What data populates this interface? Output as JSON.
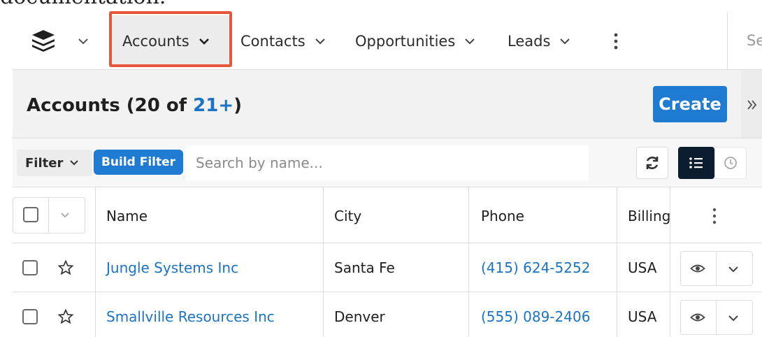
{
  "caption": "documentation.",
  "nav": {
    "tabs": [
      {
        "label": "Accounts"
      },
      {
        "label": "Contacts"
      },
      {
        "label": "Opportunities"
      },
      {
        "label": "Leads"
      }
    ],
    "search_placeholder": "Sea"
  },
  "list": {
    "title": "Accounts (20 of ",
    "count": "21+",
    "title_close": ")",
    "create_label": "Create"
  },
  "filter": {
    "filter_label": "Filter",
    "build_filter_label": "Build Filter",
    "search_placeholder": "Search by name..."
  },
  "table": {
    "columns": [
      "Name",
      "City",
      "Phone",
      "Billing"
    ],
    "rows": [
      {
        "name": "Jungle Systems Inc",
        "city": "Santa Fe",
        "phone": "(415) 624-5252",
        "billing": "USA"
      },
      {
        "name": "Smallville Resources Inc",
        "city": "Denver",
        "phone": "(555) 089-2406",
        "billing": "USA"
      }
    ]
  },
  "colors": {
    "accent": "#1f7ad1",
    "highlight": "#e8553d",
    "link": "#1a73c4",
    "dark": "#0b1d2e"
  }
}
